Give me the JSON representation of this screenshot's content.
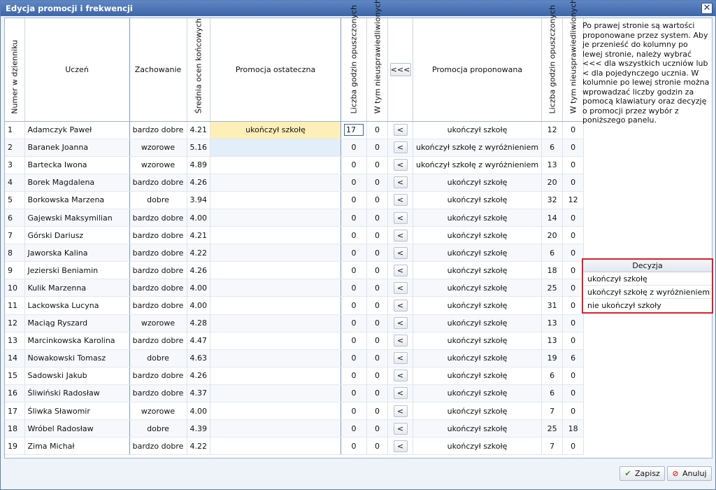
{
  "window": {
    "title": "Edycja promocji i frekwencji",
    "close_glyph": "✕"
  },
  "columns": {
    "num": "Numer w dzienniku",
    "student": "Uczeń",
    "behavior": "Zachowanie",
    "avg": "Średnia ocen końcowych",
    "final_promotion": "Promocja ostateczna",
    "missed_hours": "Liczba godzin opuszczonych",
    "unexcused": "W tym nieusprawiedliwionych",
    "copy_all": "<<<",
    "proposed_promotion": "Promocja proponowana",
    "missed_hours_proposed": "Liczba godzin opuszczonych",
    "unexcused_proposed": "W tym nieusprawiedliwionych"
  },
  "row_button_label": "<",
  "rows": [
    {
      "num": "1",
      "name": "Adamczyk Paweł",
      "behavior": "bardzo dobre",
      "avg": "4.21",
      "final": "ukończył szkołę",
      "hours": "17",
      "unexc": "0",
      "proposed": "ukończył szkołę",
      "p_hours": "12",
      "p_unexc": "0"
    },
    {
      "num": "2",
      "name": "Baranek Joanna",
      "behavior": "wzorowe",
      "avg": "5.16",
      "final": "",
      "hours": "0",
      "unexc": "0",
      "proposed": "ukończył szkołę z wyróżnieniem",
      "p_hours": "6",
      "p_unexc": "0"
    },
    {
      "num": "3",
      "name": "Bartecka Iwona",
      "behavior": "wzorowe",
      "avg": "4.89",
      "final": "",
      "hours": "0",
      "unexc": "0",
      "proposed": "ukończył szkołę z wyróżnieniem",
      "p_hours": "13",
      "p_unexc": "0"
    },
    {
      "num": "4",
      "name": "Borek Magdalena",
      "behavior": "bardzo dobre",
      "avg": "4.26",
      "final": "",
      "hours": "0",
      "unexc": "0",
      "proposed": "ukończył szkołę",
      "p_hours": "20",
      "p_unexc": "0"
    },
    {
      "num": "5",
      "name": "Borkowska Marzena",
      "behavior": "dobre",
      "avg": "3.94",
      "final": "",
      "hours": "0",
      "unexc": "0",
      "proposed": "ukończył szkołę",
      "p_hours": "32",
      "p_unexc": "12"
    },
    {
      "num": "6",
      "name": "Gajewski Maksymilian",
      "behavior": "bardzo dobre",
      "avg": "4.00",
      "final": "",
      "hours": "0",
      "unexc": "0",
      "proposed": "ukończył szkołę",
      "p_hours": "14",
      "p_unexc": "0"
    },
    {
      "num": "7",
      "name": "Górski Dariusz",
      "behavior": "bardzo dobre",
      "avg": "4.21",
      "final": "",
      "hours": "0",
      "unexc": "0",
      "proposed": "ukończył szkołę",
      "p_hours": "20",
      "p_unexc": "0"
    },
    {
      "num": "8",
      "name": "Jaworska Kalina",
      "behavior": "bardzo dobre",
      "avg": "4.22",
      "final": "",
      "hours": "0",
      "unexc": "0",
      "proposed": "ukończył szkołę",
      "p_hours": "6",
      "p_unexc": "0"
    },
    {
      "num": "9",
      "name": "Jezierski Beniamin",
      "behavior": "bardzo dobre",
      "avg": "4.26",
      "final": "",
      "hours": "0",
      "unexc": "0",
      "proposed": "ukończył szkołę",
      "p_hours": "18",
      "p_unexc": "0"
    },
    {
      "num": "10",
      "name": "Kulik Marzenna",
      "behavior": "bardzo dobre",
      "avg": "4.00",
      "final": "",
      "hours": "0",
      "unexc": "0",
      "proposed": "ukończył szkołę",
      "p_hours": "25",
      "p_unexc": "0"
    },
    {
      "num": "11",
      "name": "Lackowska Lucyna",
      "behavior": "bardzo dobre",
      "avg": "4.00",
      "final": "",
      "hours": "0",
      "unexc": "0",
      "proposed": "ukończył szkołę",
      "p_hours": "31",
      "p_unexc": "0"
    },
    {
      "num": "12",
      "name": "Maciąg Ryszard",
      "behavior": "wzorowe",
      "avg": "4.28",
      "final": "",
      "hours": "0",
      "unexc": "0",
      "proposed": "ukończył szkołę",
      "p_hours": "13",
      "p_unexc": "0"
    },
    {
      "num": "13",
      "name": "Marcinkowska Karolina",
      "behavior": "bardzo dobre",
      "avg": "4.47",
      "final": "",
      "hours": "0",
      "unexc": "0",
      "proposed": "ukończył szkołę",
      "p_hours": "13",
      "p_unexc": "0"
    },
    {
      "num": "14",
      "name": "Nowakowski Tomasz",
      "behavior": "dobre",
      "avg": "4.63",
      "final": "",
      "hours": "0",
      "unexc": "0",
      "proposed": "ukończył szkołę",
      "p_hours": "19",
      "p_unexc": "6"
    },
    {
      "num": "15",
      "name": "Sadowski Jakub",
      "behavior": "bardzo dobre",
      "avg": "4.26",
      "final": "",
      "hours": "0",
      "unexc": "0",
      "proposed": "ukończył szkołę",
      "p_hours": "6",
      "p_unexc": "0"
    },
    {
      "num": "16",
      "name": "Śliwiński Radosław",
      "behavior": "bardzo dobre",
      "avg": "4.37",
      "final": "",
      "hours": "0",
      "unexc": "0",
      "proposed": "ukończył szkołę",
      "p_hours": "6",
      "p_unexc": "0"
    },
    {
      "num": "17",
      "name": "Śliwka Sławomir",
      "behavior": "wzorowe",
      "avg": "4.00",
      "final": "",
      "hours": "0",
      "unexc": "0",
      "proposed": "ukończył szkołę",
      "p_hours": "7",
      "p_unexc": "0"
    },
    {
      "num": "18",
      "name": "Wróbel Radosław",
      "behavior": "dobre",
      "avg": "4.39",
      "final": "",
      "hours": "0",
      "unexc": "0",
      "proposed": "ukończył szkołę",
      "p_hours": "25",
      "p_unexc": "18"
    },
    {
      "num": "19",
      "name": "Zima Michał",
      "behavior": "bardzo dobre",
      "avg": "4.22",
      "final": "",
      "hours": "0",
      "unexc": "0",
      "proposed": "ukończył szkołę",
      "p_hours": "7",
      "p_unexc": "0"
    }
  ],
  "info_text": "Po prawej stronie są wartości proponowane przez system. Aby je przenieść do kolumny po lewej stronie, należy wybrać <<< dla wszystkich uczniów lub < dla pojedynczego ucznia. W kolumnie po lewej stronie można wprowadzać liczby godzin za pomocą klawiatury oraz decyzję o promocji przez wybór z poniższego panelu.",
  "decision_panel": {
    "header": "Decyzja",
    "options": [
      "ukończył szkołę",
      "ukończył szkołę z wyróżnieniem",
      "nie ukończył szkoły"
    ]
  },
  "footer": {
    "save_label": "Zapisz",
    "cancel_label": "Anuluj",
    "save_icon": "✔",
    "cancel_icon": "⊘"
  },
  "colors": {
    "title_bar": "#4a73b4",
    "highlight_row": "#fdefb7",
    "selected_cell": "#e3eefb",
    "decision_border": "#d8202a"
  }
}
